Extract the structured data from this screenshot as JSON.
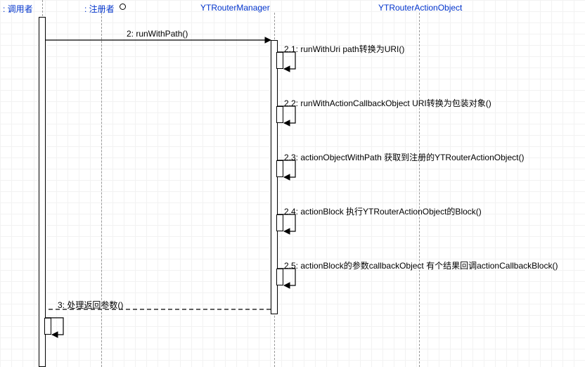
{
  "participants": [
    {
      "id": "caller",
      "label": ": 调用者"
    },
    {
      "id": "registrar",
      "label": ": 注册者"
    },
    {
      "id": "routerManager",
      "label": "YTRouterManager"
    },
    {
      "id": "routerActionObject",
      "label": "YTRouterActionObject"
    }
  ],
  "messages": [
    {
      "id": "2",
      "from": "caller",
      "to": "routerManager",
      "kind": "sync",
      "label": "2: runWithPath()"
    },
    {
      "id": "2.1",
      "from": "routerManager",
      "to": "routerManager",
      "kind": "self",
      "label": "2.1: runWithUri path转换为URI()"
    },
    {
      "id": "2.2",
      "from": "routerManager",
      "to": "routerManager",
      "kind": "self",
      "label": "2.2: runWithActionCallbackObject URI转换为包装对象()"
    },
    {
      "id": "2.3",
      "from": "routerManager",
      "to": "routerManager",
      "kind": "self",
      "label": "2.3: actionObjectWithPath 获取到注册的YTRouterActionObject()"
    },
    {
      "id": "2.4",
      "from": "routerManager",
      "to": "routerManager",
      "kind": "self",
      "label": "2.4: actionBlock 执行YTRouterActionObject的Block()"
    },
    {
      "id": "2.5",
      "from": "routerManager",
      "to": "routerManager",
      "kind": "self",
      "label": "2.5: actionBlock的参数callbackObject 有个结果回调actionCallbackBlock()"
    },
    {
      "id": "3",
      "from": "routerManager",
      "to": "caller",
      "kind": "return",
      "label": "3: 处理返回参数()"
    }
  ],
  "chart_data": {
    "type": "table",
    "title": "UML Sequence Diagram — YTRouter runWithPath flow",
    "participants": [
      "调用者",
      "注册者",
      "YTRouterManager",
      "YTRouterActionObject"
    ],
    "steps": [
      {
        "n": "2",
        "from": "调用者",
        "to": "YTRouterManager",
        "dashed": false,
        "text": "runWithPath()"
      },
      {
        "n": "2.1",
        "from": "YTRouterManager",
        "to": "YTRouterManager",
        "dashed": false,
        "text": "runWithUri path转换为URI()"
      },
      {
        "n": "2.2",
        "from": "YTRouterManager",
        "to": "YTRouterManager",
        "dashed": false,
        "text": "runWithActionCallbackObject URI转换为包装对象()"
      },
      {
        "n": "2.3",
        "from": "YTRouterManager",
        "to": "YTRouterManager",
        "dashed": false,
        "text": "actionObjectWithPath 获取到注册的YTRouterActionObject()"
      },
      {
        "n": "2.4",
        "from": "YTRouterManager",
        "to": "YTRouterManager",
        "dashed": false,
        "text": "actionBlock 执行YTRouterActionObject的Block()"
      },
      {
        "n": "2.5",
        "from": "YTRouterManager",
        "to": "YTRouterManager",
        "dashed": false,
        "text": "actionBlock的参数callbackObject 有个结果回调actionCallbackBlock()"
      },
      {
        "n": "3",
        "from": "YTRouterManager",
        "to": "调用者",
        "dashed": true,
        "text": "处理返回参数()"
      }
    ]
  }
}
